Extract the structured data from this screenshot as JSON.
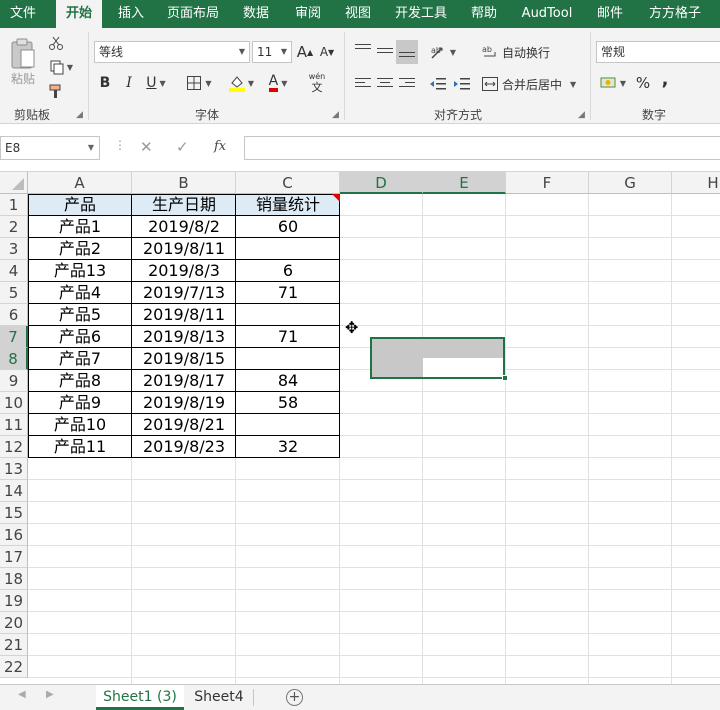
{
  "tabs": [
    {
      "label": "文件",
      "active": false
    },
    {
      "label": "开始",
      "active": true
    },
    {
      "label": "插入",
      "active": false
    },
    {
      "label": "页面布局",
      "active": false
    },
    {
      "label": "数据",
      "active": false
    },
    {
      "label": "审阅",
      "active": false
    },
    {
      "label": "视图",
      "active": false
    },
    {
      "label": "开发工具",
      "active": false
    },
    {
      "label": "帮助",
      "active": false
    },
    {
      "label": "AudTool",
      "active": false
    },
    {
      "label": "邮件",
      "active": false
    },
    {
      "label": "方方格子",
      "active": false
    }
  ],
  "ribbon": {
    "clipboard": {
      "label": "剪贴板",
      "paste_label": "粘贴"
    },
    "font": {
      "label": "字体",
      "font_name": "等线",
      "font_size": "11",
      "grow": "A",
      "shrink": "A",
      "bold": "B",
      "italic": "I",
      "underline": "U",
      "font_color": "A",
      "phonetic_top": "wén",
      "phonetic_bottom": "文"
    },
    "alignment": {
      "label": "对齐方式",
      "wrap_text": "自动换行",
      "merge_center": "合并后居中"
    },
    "number": {
      "label": "数字",
      "format": "常规",
      "percent": "%",
      "comma": ","
    }
  },
  "formula_bar": {
    "name_box": "E8",
    "cancel": "✕",
    "enter": "✓",
    "fx": "fx",
    "content": ""
  },
  "grid": {
    "columns": [
      "A",
      "B",
      "C",
      "D",
      "E",
      "F",
      "G",
      "H"
    ],
    "rows": [
      "1",
      "2",
      "3",
      "4",
      "5",
      "6",
      "7",
      "8",
      "9",
      "10",
      "11",
      "12",
      "13",
      "14",
      "15",
      "16",
      "17",
      "18",
      "19",
      "20",
      "21",
      "22"
    ],
    "selected_columns": [
      "D",
      "E"
    ],
    "selected_rows": [
      "7",
      "8"
    ],
    "header": [
      "产品",
      "生产日期",
      "销量统计"
    ],
    "data": [
      [
        "产品1",
        "2019/8/2",
        "60"
      ],
      [
        "产品2",
        "2019/8/11",
        ""
      ],
      [
        "产品13",
        "2019/8/3",
        "6"
      ],
      [
        "产品4",
        "2019/7/13",
        "71"
      ],
      [
        "产品5",
        "2019/8/11",
        ""
      ],
      [
        "产品6",
        "2019/8/13",
        "71"
      ],
      [
        "产品7",
        "2019/8/15",
        ""
      ],
      [
        "产品8",
        "2019/8/17",
        "84"
      ],
      [
        "产品9",
        "2019/8/19",
        "58"
      ],
      [
        "产品10",
        "2019/8/21",
        ""
      ],
      [
        "产品11",
        "2019/8/23",
        "32"
      ]
    ]
  },
  "sheets": [
    {
      "label": "Sheet1 (3)",
      "active": true
    },
    {
      "label": "Sheet4",
      "active": false
    }
  ],
  "colors": {
    "accent": "#217346",
    "header_fill": "#ddebf7",
    "selection_fill": "#c8c8c8"
  }
}
